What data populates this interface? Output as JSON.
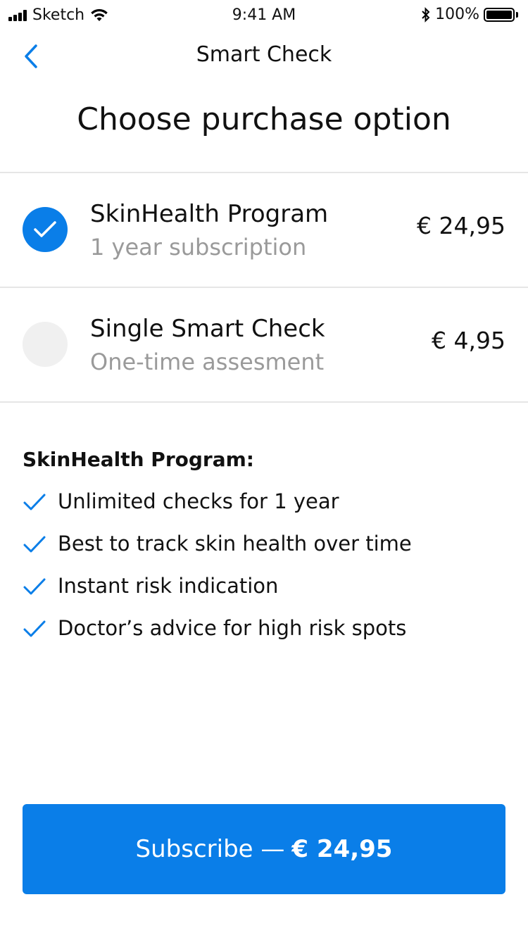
{
  "status_bar": {
    "carrier": "Sketch",
    "time": "9:41 AM",
    "battery_percent": "100%",
    "battery_level": 1.0,
    "icons": [
      "signal-icon",
      "wifi-icon",
      "bluetooth-icon",
      "battery-icon"
    ]
  },
  "nav": {
    "title": "Smart Check",
    "back_icon": "chevron-left-icon"
  },
  "page": {
    "title": "Choose purchase option"
  },
  "options": [
    {
      "title": "SkinHealth Program",
      "subtitle": "1 year subscription",
      "price": "€ 24,95",
      "selected": true
    },
    {
      "title": "Single Smart Check",
      "subtitle": "One-time assesment",
      "price": "€ 4,95",
      "selected": false
    }
  ],
  "features": {
    "title": "SkinHealth Program:",
    "items": [
      "Unlimited checks for 1 year",
      "Best to track skin health over time",
      "Instant risk indication",
      "Doctor’s advice for high risk spots"
    ]
  },
  "subscribe": {
    "label": "Subscribe —",
    "price": "€ 24,95"
  },
  "colors": {
    "accent": "#0a7ee8",
    "muted_text": "#9a9a9a",
    "divider": "#e6e6e6",
    "unselected_radio": "#f0f0f0"
  }
}
